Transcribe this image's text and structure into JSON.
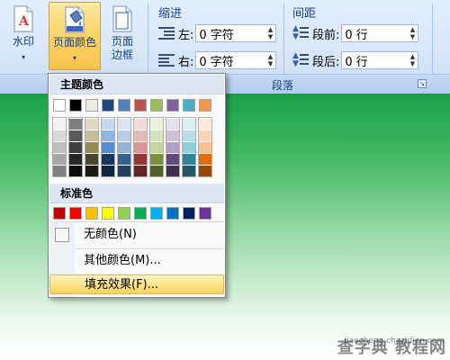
{
  "ribbon": {
    "watermark_btn": {
      "label": "水印"
    },
    "page_color_btn": {
      "label": "页面颜色"
    },
    "page_border_btn": {
      "label_line1": "页面",
      "label_line2": "边框"
    },
    "indent": {
      "title": "缩进",
      "left_label": "左:",
      "left_value": "0 字符",
      "right_label": "右:",
      "right_value": "0 字符"
    },
    "spacing": {
      "title": "间距",
      "before_label": "段前:",
      "before_value": "0 行",
      "after_label": "段后:",
      "after_value": "0 行"
    },
    "paragraph_group_label": "段落"
  },
  "dropdown": {
    "theme_colors_title": "主题颜色",
    "standard_colors_title": "标准色",
    "theme_colors": [
      "#ffffff",
      "#000000",
      "#eeece1",
      "#1f497d",
      "#4f81bd",
      "#c0504d",
      "#9bbb59",
      "#8064a2",
      "#4bacc6",
      "#f79646"
    ],
    "theme_shades": [
      [
        "#f2f2f2",
        "#d9d9d9",
        "#bfbfbf",
        "#a6a6a6",
        "#808080"
      ],
      [
        "#7f7f7f",
        "#595959",
        "#404040",
        "#262626",
        "#0d0d0d"
      ],
      [
        "#ddd9c3",
        "#c4bd97",
        "#948a54",
        "#4a452a",
        "#1d1b10"
      ],
      [
        "#c6d9f0",
        "#8db3e2",
        "#548dd4",
        "#17365d",
        "#0f243e"
      ],
      [
        "#dbe5f1",
        "#b8cce4",
        "#95b3d7",
        "#366092",
        "#244061"
      ],
      [
        "#f2dcdb",
        "#e5b9b7",
        "#d99694",
        "#953734",
        "#632423"
      ],
      [
        "#ebf1dd",
        "#d7e3bc",
        "#c3d69b",
        "#76923c",
        "#4f6128"
      ],
      [
        "#e5e0ec",
        "#ccc1d9",
        "#b2a2c7",
        "#5f497a",
        "#3f3151"
      ],
      [
        "#dbeef3",
        "#b7dde8",
        "#92cddc",
        "#31859b",
        "#205867"
      ],
      [
        "#fdeada",
        "#fbd5b5",
        "#fac08f",
        "#e36c09",
        "#974806"
      ]
    ],
    "standard_colors": [
      "#c00000",
      "#ff0000",
      "#ffc000",
      "#ffff00",
      "#92d050",
      "#00b050",
      "#00b0f0",
      "#0070c0",
      "#002060",
      "#7030a0"
    ],
    "no_color_label": "无颜色(N)",
    "more_colors_label": "其他颜色(M)...",
    "fill_effects_label": "填充效果(F)..."
  },
  "watermark_site": {
    "text": "查字典 教程网",
    "url": "jiaocheng.chazidian.com"
  }
}
